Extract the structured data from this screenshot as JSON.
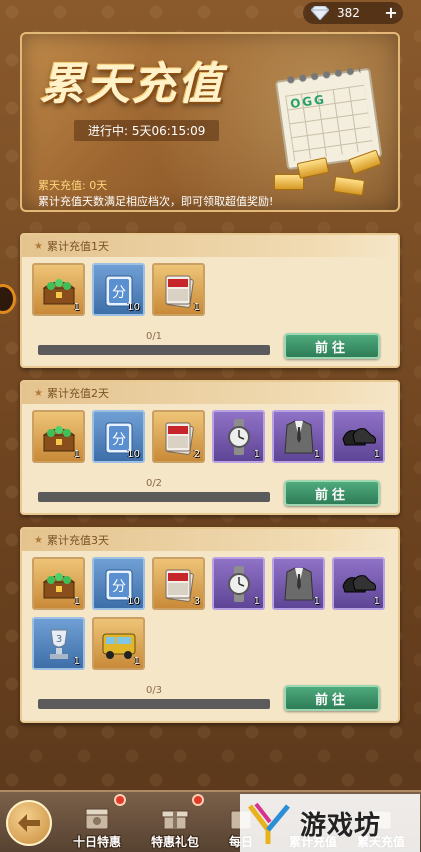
{
  "currency": {
    "value": "382",
    "icon": "diamond-icon"
  },
  "banner": {
    "title": "累天充值",
    "timer": "进行中: 5天06:15:09",
    "progress": "累天充值: 0天",
    "desc": "累计充值天数满足相应档次，即可领取超值奖励!",
    "calendar_marks": "OGG"
  },
  "tiers": [
    {
      "title": "累计充值1天",
      "progress_text": "0/1",
      "progress": 0,
      "button": "前往",
      "items": [
        {
          "kind": "treasure-chest",
          "color": "gold",
          "count": "1"
        },
        {
          "kind": "score-card",
          "color": "blue",
          "count": "10",
          "glyph": "分"
        },
        {
          "kind": "red-card-pack",
          "color": "gold",
          "count": "1"
        }
      ]
    },
    {
      "title": "累计充值2天",
      "progress_text": "0/2",
      "progress": 0,
      "button": "前往",
      "items": [
        {
          "kind": "treasure-chest",
          "color": "gold",
          "count": "1"
        },
        {
          "kind": "score-card",
          "color": "blue",
          "count": "10",
          "glyph": "分"
        },
        {
          "kind": "red-card-pack",
          "color": "gold",
          "count": "2"
        },
        {
          "kind": "watch",
          "color": "purple",
          "count": "1"
        },
        {
          "kind": "suit",
          "color": "purple",
          "count": "1"
        },
        {
          "kind": "shoes",
          "color": "purple",
          "count": "1"
        }
      ]
    },
    {
      "title": "累计充值3天",
      "progress_text": "0/3",
      "progress": 0,
      "button": "前往",
      "items": [
        {
          "kind": "treasure-chest",
          "color": "gold",
          "count": "1"
        },
        {
          "kind": "score-card",
          "color": "blue",
          "count": "10",
          "glyph": "分"
        },
        {
          "kind": "red-card-pack",
          "color": "gold",
          "count": "3"
        },
        {
          "kind": "watch",
          "color": "purple",
          "count": "1"
        },
        {
          "kind": "suit",
          "color": "purple",
          "count": "1"
        },
        {
          "kind": "shoes",
          "color": "purple",
          "count": "1"
        },
        {
          "kind": "trophy",
          "color": "blue",
          "count": "1"
        },
        {
          "kind": "van",
          "color": "gold",
          "count": "1"
        }
      ]
    }
  ],
  "nav": {
    "tabs": [
      {
        "label": "十日特惠",
        "badge": true
      },
      {
        "label": "特惠礼包",
        "badge": true
      },
      {
        "label": "每日",
        "badge": false
      },
      {
        "label": "累计充值",
        "badge": false
      },
      {
        "label": "累天充值",
        "badge": false
      }
    ]
  },
  "watermark": {
    "text": "游戏坊"
  },
  "colors": {
    "accent_green": "#2e7d57",
    "card_bg": "#f6e6c8",
    "badge_red": "#e23b2c"
  }
}
